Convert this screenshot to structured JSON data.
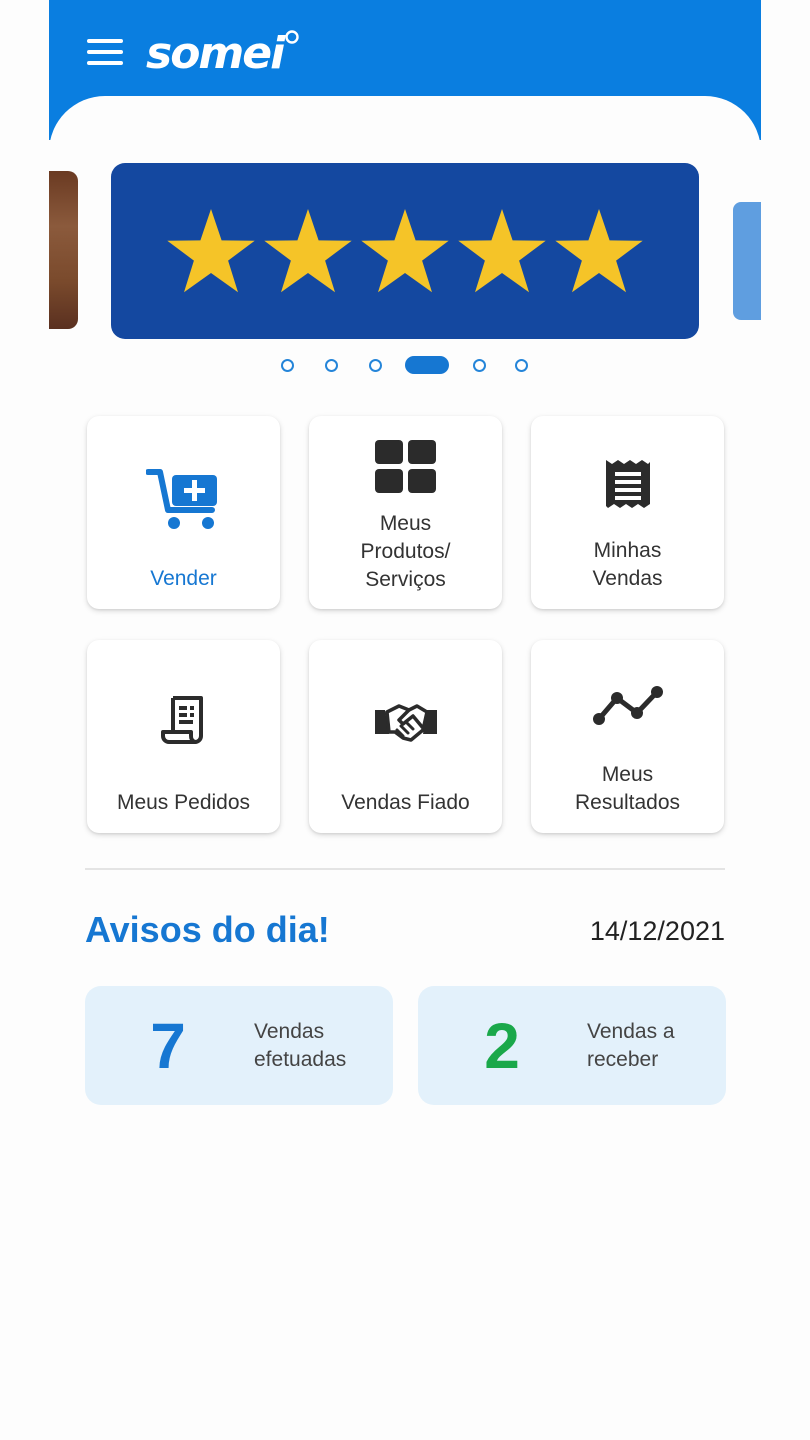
{
  "header": {
    "logo_text": "somei",
    "menu_icon": "hamburger-menu-icon",
    "background_color": "#0a7ee0"
  },
  "carousel": {
    "slide_count": 6,
    "active_index": 3,
    "active_color": "#1677d2",
    "main_slide": {
      "background_color": "#1448a0",
      "rating_stars": 5,
      "star_color": "#f5c428"
    }
  },
  "tiles": [
    {
      "label": "Vender",
      "icon": "add-to-cart-icon",
      "highlight": true
    },
    {
      "label": "Meus\nProdutos/\nServiços",
      "icon": "grid-icon"
    },
    {
      "label": "Minhas\nVendas",
      "icon": "receipt-icon"
    },
    {
      "label": "Meus Pedidos",
      "icon": "order-document-icon"
    },
    {
      "label": "Vendas Fiado",
      "icon": "handshake-icon"
    },
    {
      "label": "Meus\nResultados",
      "icon": "line-chart-icon"
    }
  ],
  "avisos": {
    "title": "Avisos do dia!",
    "date": "14/12/2021",
    "cards": [
      {
        "value": "7",
        "label": "Vendas\nefetuadas",
        "color": "#1677d2"
      },
      {
        "value": "2",
        "label": "Vendas a\nreceber",
        "color": "#1aa84a"
      }
    ]
  },
  "colors": {
    "primary": "#1677d2",
    "card_background": "#e3f1fb",
    "text_dark": "#333333"
  }
}
